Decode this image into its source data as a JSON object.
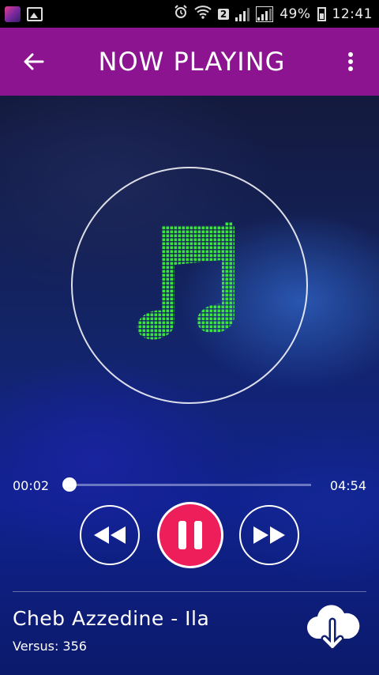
{
  "status_bar": {
    "sim_badge": "2",
    "battery_percent": "49%",
    "time": "12:41"
  },
  "header": {
    "title": "NOW PLAYING"
  },
  "player": {
    "current_time": "00:02",
    "total_time": "04:54",
    "progress": 0.007
  },
  "track": {
    "title": "Cheb Azzedine - Ila",
    "subtitle": "Versus: 356"
  },
  "colors": {
    "app_bar": "#8c1491",
    "pause_button": "#ee1e5b",
    "note_icon": "#39e639"
  }
}
